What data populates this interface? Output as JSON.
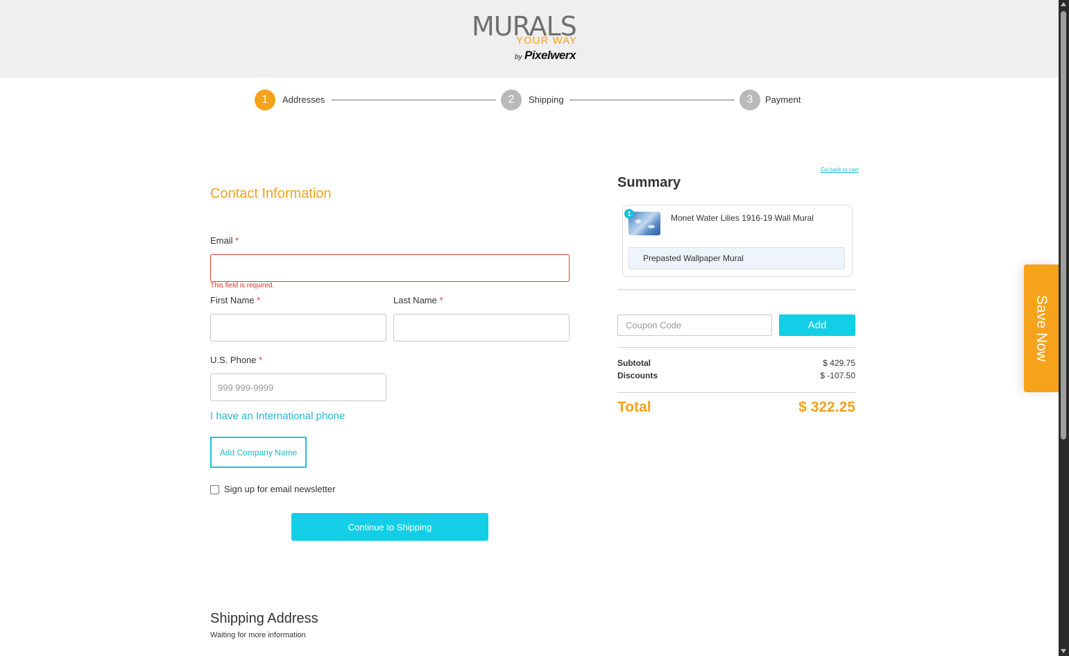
{
  "brand": {
    "main": "MURALS",
    "sub": "YOUR WAY",
    "by": "by",
    "company": "Pixelwerx"
  },
  "steps": [
    {
      "number": "1",
      "label": "Addresses"
    },
    {
      "number": "2",
      "label": "Shipping"
    },
    {
      "number": "3",
      "label": "Payment"
    }
  ],
  "contact": {
    "title": "Contact Information",
    "email_label": "Email",
    "required_mark": "*",
    "email_error": "This field is required.",
    "first_name_label": "First Name",
    "last_name_label": "Last Name",
    "phone_label": "U.S. Phone",
    "phone_placeholder": "999 999-9999",
    "international_link": "I have an International phone",
    "company_button": "Add Company Name",
    "newsletter_label": "Sign up for email newsletter",
    "continue_button": "Continue to Shipping"
  },
  "shipping": {
    "title": "Shipping Address",
    "status": "Waiting for more information"
  },
  "summary": {
    "back_link": "Go back to cart",
    "title": "Summary",
    "item": {
      "quantity": "1",
      "name": "Monet Water Lilies 1916-19 Wall Mural",
      "variant": "Prepasted Wallpaper Mural"
    },
    "coupon_placeholder": "Coupon Code",
    "add_button": "Add",
    "subtotal_label": "Subtotal",
    "subtotal_value": "$ 429.75",
    "discounts_label": "Discounts",
    "discounts_value": "$ -107.50",
    "total_label": "Total",
    "total_value": "$ 322.25"
  },
  "promo_tab": "Save Now",
  "colors": {
    "accent_orange": "#f7a21b",
    "accent_cyan": "#13cee6",
    "error_red": "#e53b3b"
  }
}
